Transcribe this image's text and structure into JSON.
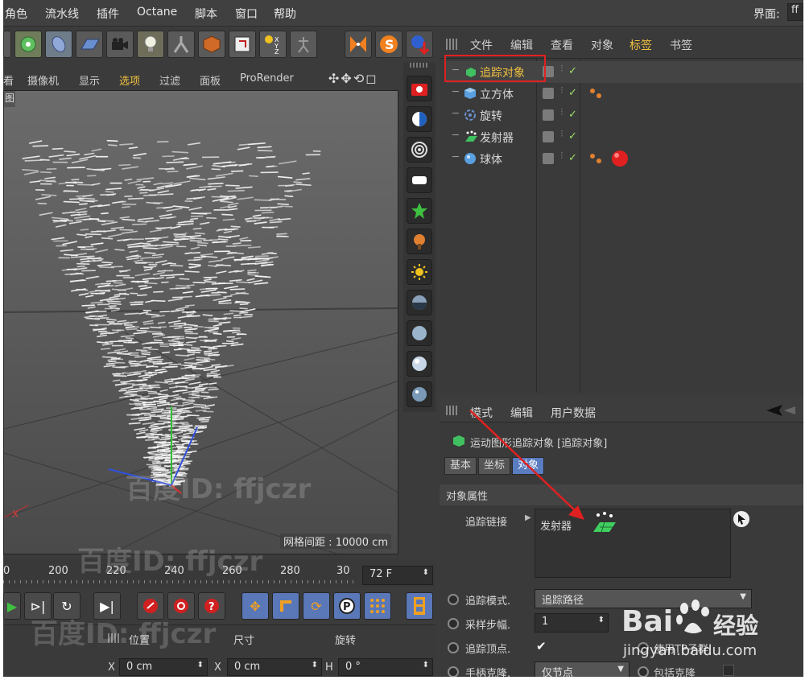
{
  "menubar": {
    "items": [
      "角色",
      "流水线",
      "插件",
      "Octane",
      "脚本",
      "窗口",
      "帮助"
    ],
    "layout_label": "界面:",
    "layout_value": "ff"
  },
  "viewport_menu": {
    "items": [
      "查看",
      "摄像机",
      "显示",
      "选项",
      "过滤",
      "面板",
      "ProRender"
    ],
    "active": "选项",
    "corner_label": "图",
    "grid_spacing": "网格间距 : 10000 cm"
  },
  "object_manager": {
    "menu": [
      "文件",
      "编辑",
      "查看",
      "对象",
      "标签",
      "书签"
    ],
    "objects": [
      {
        "name": "追踪对象",
        "icon": "tracer-icon",
        "selected": true
      },
      {
        "name": "立方体",
        "icon": "cube-icon"
      },
      {
        "name": "旋转",
        "icon": "rotate-deformer-icon"
      },
      {
        "name": "发射器",
        "icon": "emitter-icon"
      },
      {
        "name": "球体",
        "icon": "sphere-icon"
      }
    ]
  },
  "attribute_manager": {
    "menu": [
      "模式",
      "编辑",
      "用户数据"
    ],
    "object_title": "运动图形追踪对象 [追踪对象]",
    "tabs": [
      "基本",
      "坐标",
      "对象"
    ],
    "active_tab": "对象",
    "section": "对象属性",
    "trace_link_label": "追踪链接",
    "trace_link_value": "发射器",
    "params": [
      {
        "label": "追踪模式.",
        "value": "追踪路径"
      },
      {
        "label": "采样步幅.",
        "value": "1"
      },
      {
        "label": "追踪顶点.",
        "value": "✔"
      },
      {
        "label": "手柄克隆.",
        "value": "仅节点"
      }
    ],
    "right_labels": [
      "使用TP子群",
      "包括克隆"
    ]
  },
  "timeline": {
    "ticks": [
      "0",
      "200",
      "220",
      "240",
      "260",
      "280",
      "30"
    ],
    "frame": "72 F"
  },
  "coordinates": {
    "headers": [
      "位置",
      "尺寸",
      "旋转"
    ],
    "fields": [
      {
        "axis": "X",
        "value": "0 cm"
      },
      {
        "axis": "X",
        "value": "0 cm"
      },
      {
        "axis": "H",
        "value": "0 °"
      }
    ]
  },
  "watermarks": {
    "baidu_id": "百度ID: ffjczr",
    "site": "jingyan.baidu.com",
    "brand": "Bai",
    "brand2": "经验"
  },
  "colors": {
    "highlight_border": "#e02020",
    "arrow": "#e02020",
    "active_text": "#f0c040",
    "selected_name": "#f0c040"
  }
}
